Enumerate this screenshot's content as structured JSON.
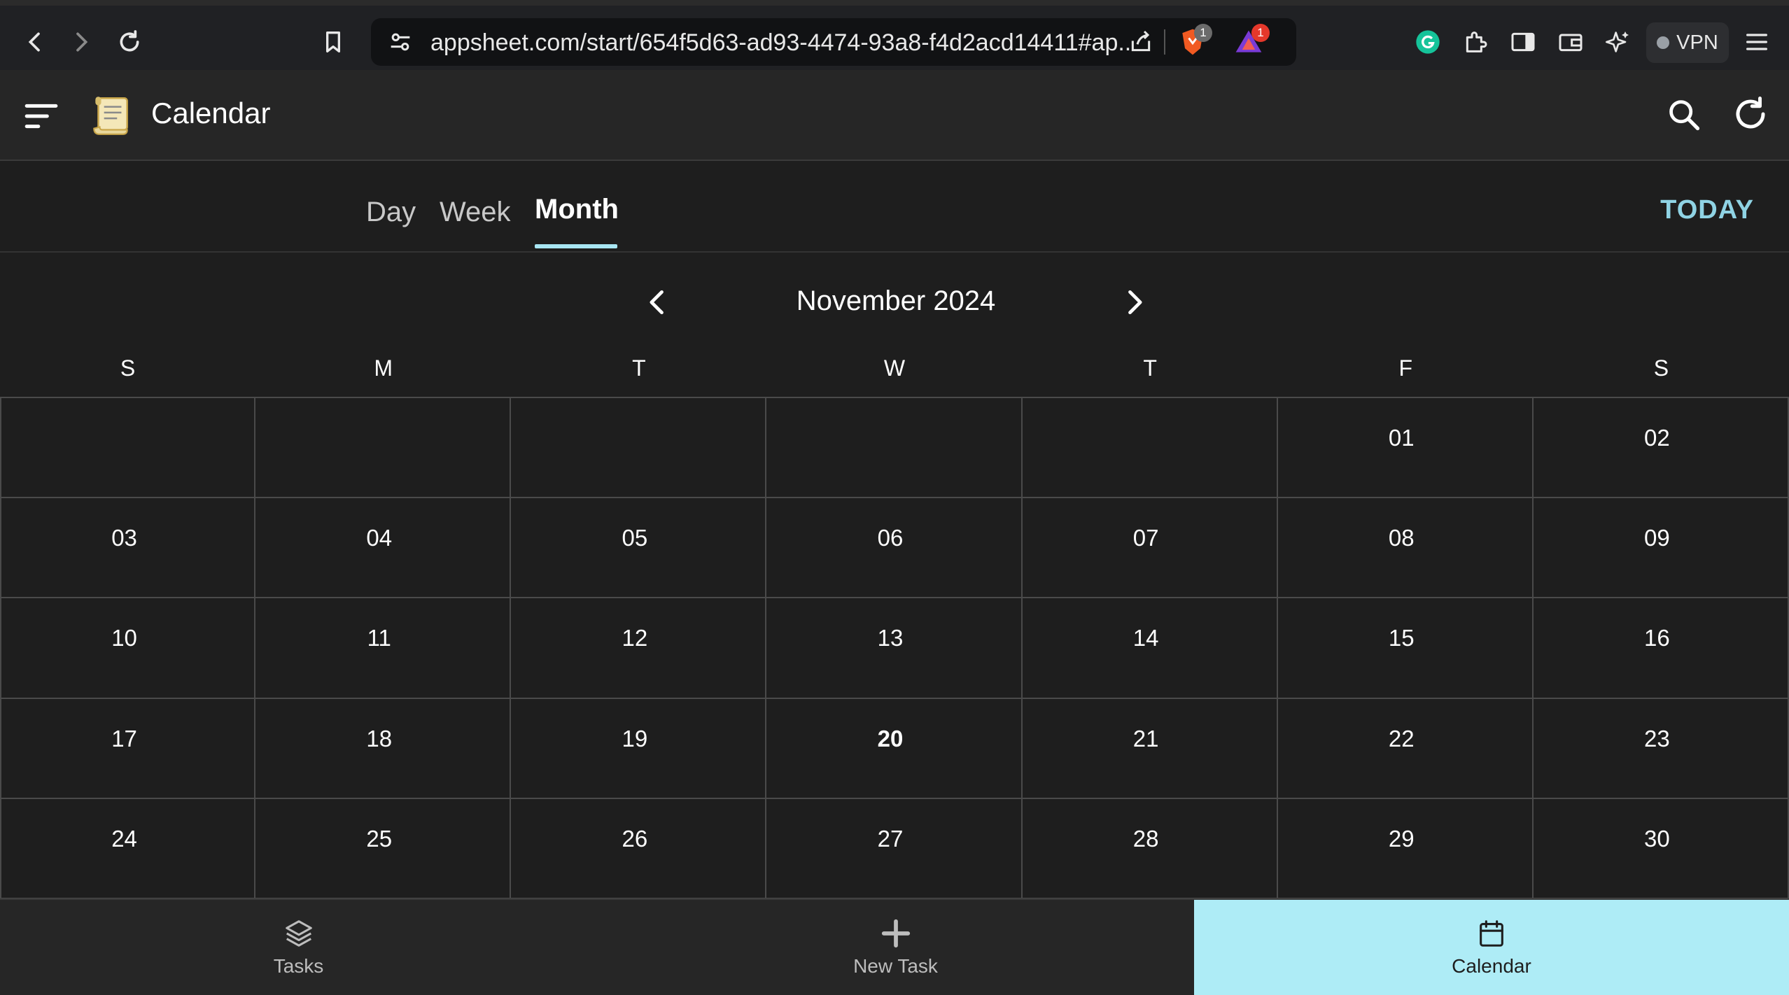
{
  "browser": {
    "url": "appsheet.com/start/654f5d63-ad93-4474-93a8-f4d2acd14411#ap...",
    "brave_badge": "1",
    "alert_badge": "1",
    "vpn_label": "VPN"
  },
  "app": {
    "title": "Calendar"
  },
  "tabs": [
    {
      "label": "Day"
    },
    {
      "label": "Week"
    },
    {
      "label": "Month"
    }
  ],
  "today_label": "TODAY",
  "month": {
    "title": "November 2024"
  },
  "weekdays": [
    "S",
    "M",
    "T",
    "W",
    "T",
    "F",
    "S"
  ],
  "weeks": [
    [
      "",
      "",
      "",
      "",
      "",
      "01",
      "02"
    ],
    [
      "03",
      "04",
      "05",
      "06",
      "07",
      "08",
      "09"
    ],
    [
      "10",
      "11",
      "12",
      "13",
      "14",
      "15",
      "16"
    ],
    [
      "17",
      "18",
      "19",
      "20",
      "21",
      "22",
      "23"
    ],
    [
      "24",
      "25",
      "26",
      "27",
      "28",
      "29",
      "30"
    ]
  ],
  "today_day": "20",
  "bottom_nav": [
    {
      "label": "Tasks",
      "icon": "layers-icon"
    },
    {
      "label": "New Task",
      "icon": "plus-icon"
    },
    {
      "label": "Calendar",
      "icon": "calendar-icon"
    }
  ],
  "colors": {
    "accent": "#8fd3e4",
    "active_nav_bg": "#aeecf6",
    "background": "#1e1e1e",
    "header": "#262626"
  }
}
